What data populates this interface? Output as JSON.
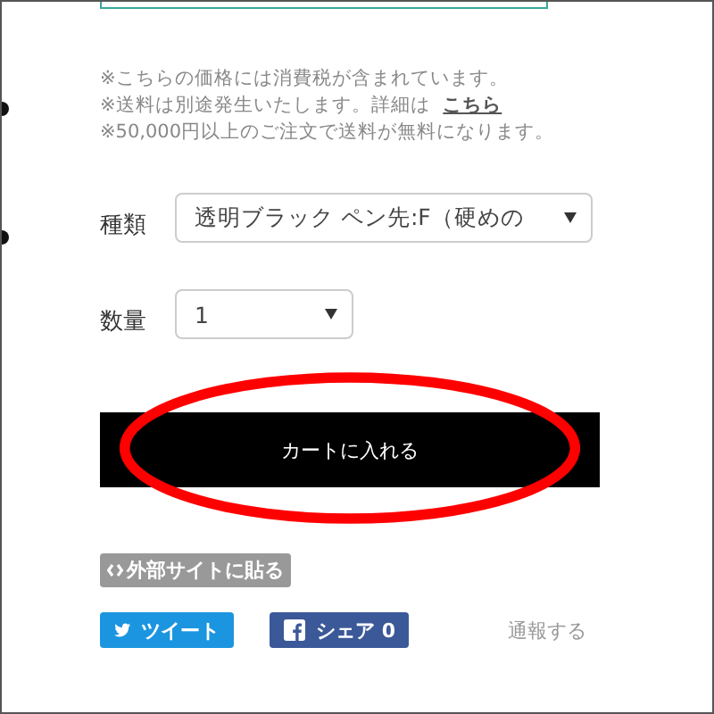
{
  "notes": [
    {
      "text": "※こちらの価格には消費税が含まれています。"
    },
    {
      "text": "※送料は別途発生いたします。詳細は",
      "link": "こちら"
    },
    {
      "text": "※50,000円以上のご注文で送料が無料になります。"
    }
  ],
  "options": [
    {
      "label": "種類",
      "value": "透明ブラック ペン先:F（硬めの"
    },
    {
      "label": "数量",
      "value": "1"
    }
  ],
  "cart_button": "カートに入れる",
  "embed_badge": "外部サイトに貼る",
  "share": [
    {
      "kind": "twitter",
      "label": "ツイート"
    },
    {
      "kind": "facebook",
      "label": "シェア 0"
    }
  ],
  "report_link": "通報する"
}
